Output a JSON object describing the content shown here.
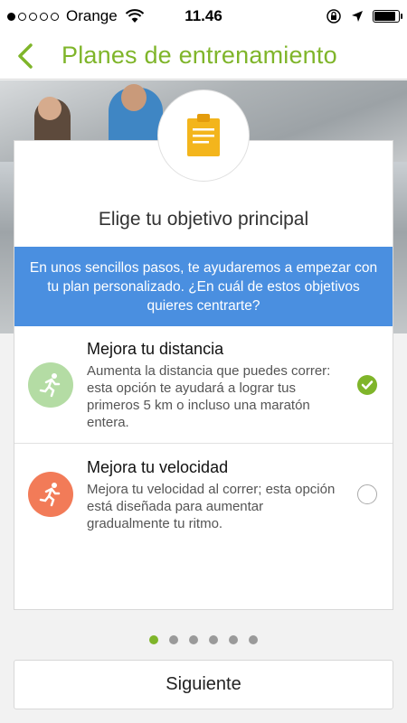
{
  "status_bar": {
    "carrier": "Orange",
    "time": "11.46",
    "signal_filled": 1,
    "signal_total": 5,
    "battery_level": 0.9
  },
  "nav": {
    "title": "Planes de entrenamiento",
    "back_icon": "chevron-left-icon"
  },
  "card": {
    "title": "Elige tu objetivo principal",
    "icon": "clipboard-icon",
    "banner_text": "En unos sencillos pasos, te ayudaremos a empezar con tu plan personalizado. ¿En cuál de estos objetivos quieres centrarte?",
    "options": [
      {
        "title": "Mejora tu distancia",
        "description": "Aumenta la distancia que puedes correr: esta opción te ayudará a lograr tus primeros 5 km o incluso una maratón entera.",
        "icon": "runner-icon",
        "icon_color": "#b4dca4",
        "selected": true
      },
      {
        "title": "Mejora tu velocidad",
        "description": "Mejora tu velocidad al correr; esta opción está diseñada para aumentar gradualmente tu ritmo.",
        "icon": "runner-icon",
        "icon_color": "#f27b58",
        "selected": false
      }
    ]
  },
  "pagination": {
    "total": 6,
    "current": 1
  },
  "next_button": {
    "label": "Siguiente"
  },
  "colors": {
    "accent": "#7fb52a",
    "banner": "#4a8fe0",
    "clipboard": "#f3b51c"
  }
}
